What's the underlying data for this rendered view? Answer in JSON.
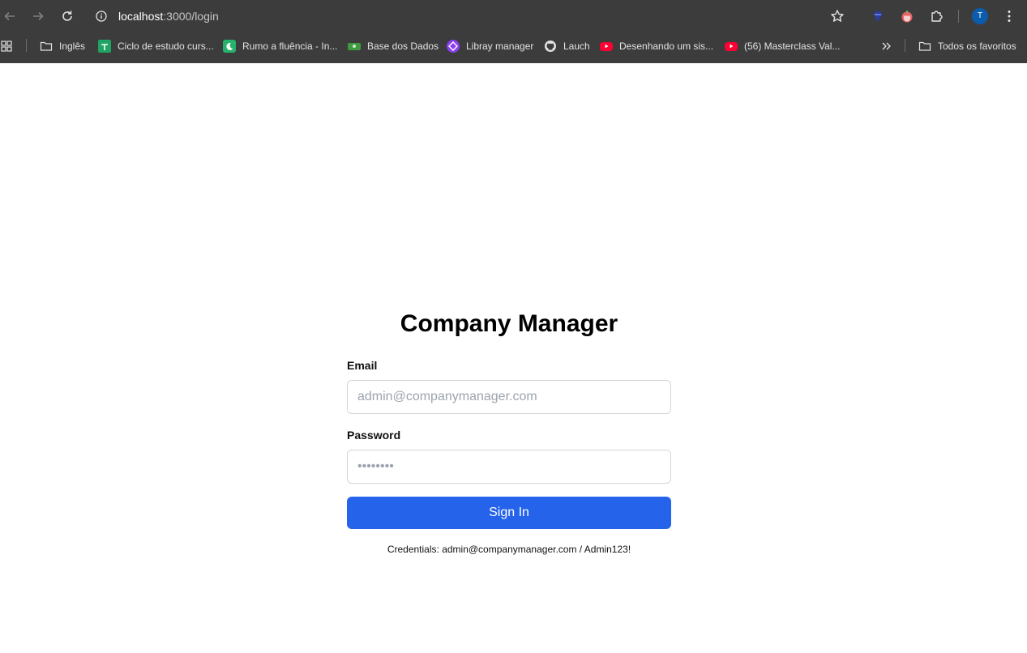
{
  "browser": {
    "url_host": "localhost",
    "url_path": ":3000/login",
    "profile_initial": "T",
    "bookmarks": [
      {
        "label": "Inglês",
        "icon": "folder-icon"
      },
      {
        "label": "Ciclo de estudo curs...",
        "icon": "sheets-icon"
      },
      {
        "label": "Rumo a fluência - In...",
        "icon": "moon-app-icon"
      },
      {
        "label": "Base dos Dados",
        "icon": "money-icon"
      },
      {
        "label": "Libray manager",
        "icon": "library-app-icon"
      },
      {
        "label": "Lauch",
        "icon": "github-icon"
      },
      {
        "label": "Desenhando um sis...",
        "icon": "youtube-icon"
      },
      {
        "label": "(56) Masterclass Val...",
        "icon": "youtube-icon"
      }
    ],
    "all_bookmarks_label": "Todos os favoritos"
  },
  "login": {
    "title": "Company Manager",
    "email_label": "Email",
    "email_placeholder": "admin@companymanager.com",
    "password_label": "Password",
    "password_placeholder": "••••••••",
    "submit_label": "Sign In",
    "credentials_hint": "Credentials: admin@companymanager.com / Admin123!"
  },
  "colors": {
    "primary": "#2563eb",
    "chrome_bg": "#3c3c3c"
  }
}
